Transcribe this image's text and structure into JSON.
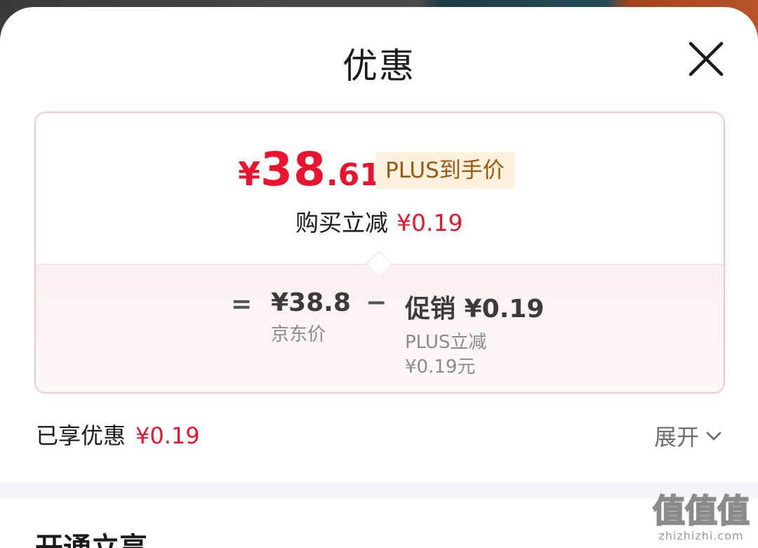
{
  "sheet": {
    "title": "优惠"
  },
  "price_card": {
    "final_price": {
      "symbol": "¥",
      "integer": "38",
      "decimal": ".61"
    },
    "plus_badge": "PLUS到手价",
    "instant_reduction": {
      "label": "购买立减",
      "amount": "¥0.19"
    },
    "calculation": {
      "equals_sign": "=",
      "base_amount": "¥38.8",
      "base_label": "京东价",
      "minus_sign": "−",
      "promo_amount": "促销 ¥0.19",
      "promo_label": "PLUS立减",
      "promo_sub_amount": "¥0.19元"
    }
  },
  "summary": {
    "enjoyed_label": "已享优惠",
    "enjoyed_amount": "¥0.19",
    "expand_label": "展开"
  },
  "next_section": {
    "title": "开通立享"
  },
  "watermark": {
    "logo_text": "值值值",
    "domain": "zhizhizhi.com"
  },
  "colors": {
    "accent_red": "#e9152e",
    "plus_badge_bg": "#fdf0dc",
    "plus_badge_text": "#9a5a12",
    "card_border": "#f5c7cd"
  }
}
